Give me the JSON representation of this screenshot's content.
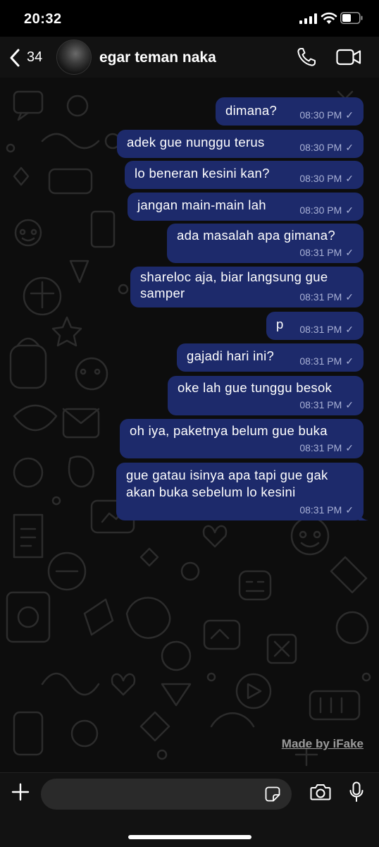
{
  "status_bar": {
    "time": "20:32"
  },
  "header": {
    "back_count": "34",
    "contact_name": "egar teman naka"
  },
  "messages": [
    {
      "text": "dimana?",
      "time": "08:30 PM",
      "check": "✓"
    },
    {
      "text": "adek gue nunggu terus",
      "time": "08:30 PM",
      "check": "✓"
    },
    {
      "text": "lo beneran kesini kan?",
      "time": "08:30 PM",
      "check": "✓"
    },
    {
      "text": "jangan main-main lah",
      "time": "08:30 PM",
      "check": "✓"
    },
    {
      "text": "ada masalah apa gimana?",
      "time": "08:31 PM",
      "check": "✓"
    },
    {
      "line1": "shareloc aja, biar langsung gue",
      "line2": "samper",
      "time": "08:31 PM",
      "check": "✓"
    },
    {
      "text": "p",
      "time": "08:31 PM",
      "check": "✓"
    },
    {
      "text": "gajadi hari ini?",
      "time": "08:31 PM",
      "check": "✓"
    },
    {
      "text": "oke lah gue tunggu besok",
      "time": "08:31 PM",
      "check": "✓"
    },
    {
      "text": "oh iya, paketnya belum gue buka",
      "time": "08:31 PM",
      "check": "✓"
    },
    {
      "line1": "gue gatau isinya apa tapi gue gak",
      "line2": "akan buka sebelum lo kesini",
      "time": "08:31 PM",
      "check": "✓"
    }
  ],
  "watermark": "Made by iFake",
  "input": {
    "placeholder": ""
  },
  "colors": {
    "bubble": "#1d2a6b",
    "background": "#0d0d0d",
    "header": "#121212"
  }
}
